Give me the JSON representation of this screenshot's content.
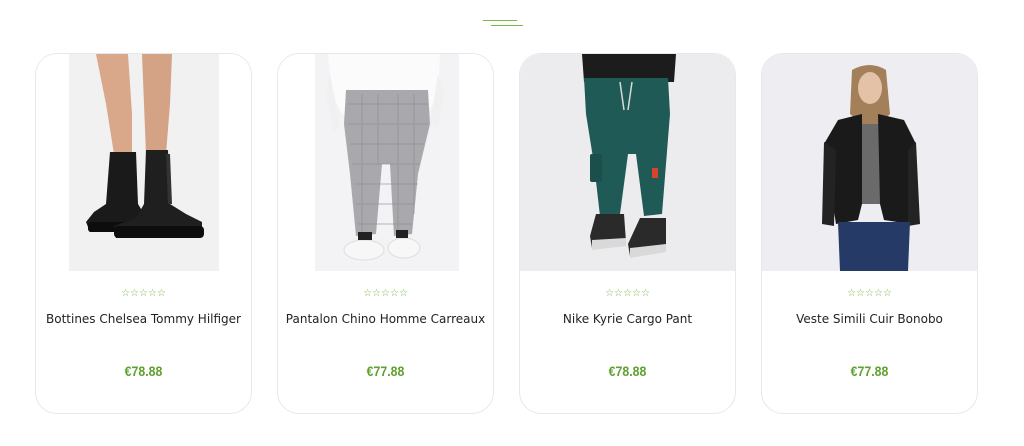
{
  "accent_color": "#7ab648",
  "price_color": "#5fa12f",
  "products": [
    {
      "name": "Bottines Chelsea Tommy Hilfiger",
      "price": "€78.88",
      "rating": "☆☆☆☆☆",
      "image_icon": "black-chelsea-boots-image"
    },
    {
      "name": "Pantalon Chino Homme Carreaux",
      "price": "€77.88",
      "rating": "☆☆☆☆☆",
      "image_icon": "checkered-chino-pants-image"
    },
    {
      "name": "Nike Kyrie Cargo Pant",
      "price": "€78.88",
      "rating": "☆☆☆☆☆",
      "image_icon": "green-cargo-pants-image"
    },
    {
      "name": "Veste Simili Cuir Bonobo",
      "price": "€77.88",
      "rating": "☆☆☆☆☆",
      "image_icon": "leather-jacket-image"
    }
  ]
}
